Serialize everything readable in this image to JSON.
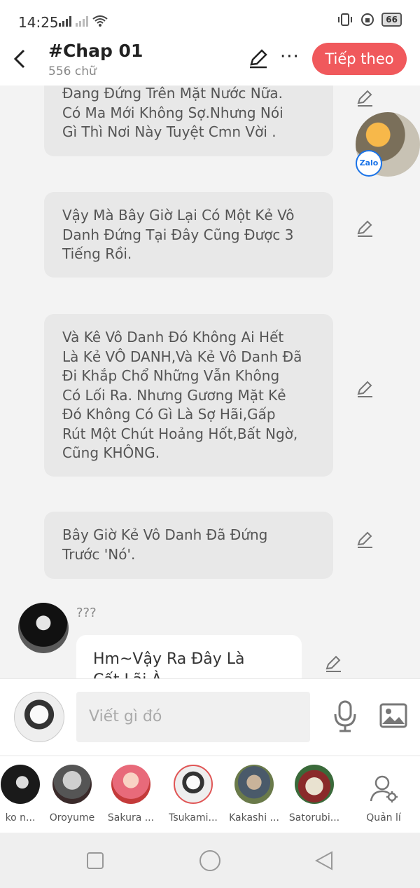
{
  "status": {
    "time": "14:25",
    "battery": "66"
  },
  "header": {
    "title": "#Chap 01",
    "word_count": "556 chữ",
    "next_label": "Tiếp theo",
    "more": "···"
  },
  "float": {
    "zalo_label": "Zalo"
  },
  "messages": [
    {
      "lines": [
        "Đang Đứng Trên Mặt Nước Nữa.",
        "Có Ma Mới Không Sợ.Nhưng Nói",
        "Gì Thì Nơi Này Tuyệt Cmn Vời ."
      ]
    },
    {
      "lines": [
        "Vậy Mà Bây Giờ Lại Có Một Kẻ Vô",
        "Danh Đứng Tại Đây Cũng Được 3",
        "Tiếng Rồi."
      ]
    },
    {
      "lines": [
        "Và Kê Vô Danh Đó Không Ai Hết",
        "Là Kẻ VÔ DANH,Và Kẻ Vô Danh Đã",
        "Đi Khắp Chổ Những Vẫn  Không",
        "Có Lối Ra. Nhưng Gương Mặt Kẻ",
        "Đó Không Có Gì Là Sợ Hãi,Gấp",
        "Rút Một Chút Hoảng Hốt,Bất Ngờ,",
        "Cũng KHÔNG."
      ]
    },
    {
      "lines": [
        "Bây Giờ Kẻ Vô Danh Đã Đứng",
        "Trước 'Nó'."
      ]
    }
  ],
  "reply": {
    "character": "???",
    "lines": [
      "Hm~Vậy Ra Đây Là",
      "Cất Lãi À"
    ]
  },
  "input": {
    "placeholder": "Viết gì đó"
  },
  "characters": [
    {
      "name": "ko n..."
    },
    {
      "name": "Oroyume"
    },
    {
      "name": "Sakura ..."
    },
    {
      "name": "Tsukami..."
    },
    {
      "name": "Kakashi ..."
    },
    {
      "name": "Satorubi..."
    }
  ],
  "manage_label": "Quản lí",
  "colors": {
    "accent": "#f0595c",
    "bubble": "#e8e8e8",
    "background": "#f3f3f3"
  }
}
